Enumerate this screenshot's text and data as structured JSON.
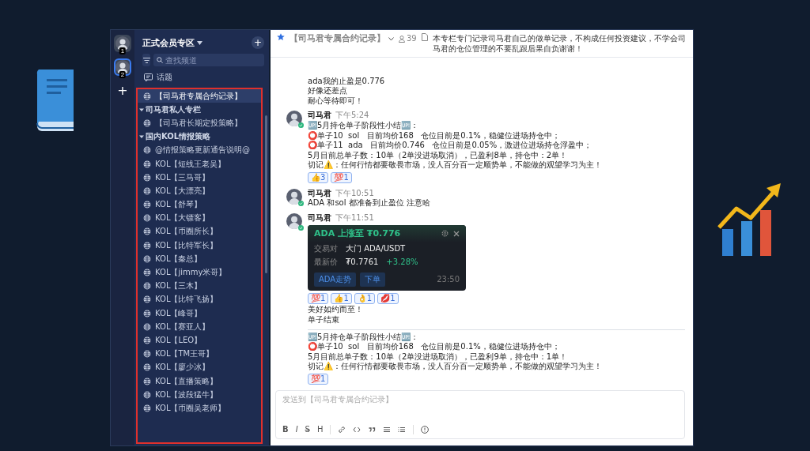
{
  "servers": [
    {
      "badge": "1",
      "selected": false
    },
    {
      "badge": "2",
      "selected": true
    }
  ],
  "add_server": "+",
  "sidebar": {
    "title": "正式会员专区",
    "add": "+",
    "search_placeholder": "查找频道",
    "topics": "话题",
    "channels": [
      {
        "name": "【司马君专属合约记录】",
        "selected": true
      }
    ],
    "categories": [
      {
        "name": "司马君私人专栏",
        "expanded": true,
        "channels": [
          {
            "name": "【司马君长期定投策略】",
            "selected": false
          }
        ]
      },
      {
        "name": "国内KOL情报策略",
        "expanded": true,
        "channels": [
          {
            "name": "@情报策略更新通告说明@",
            "selected": false
          },
          {
            "name": "KOL【短线王老吴】",
            "selected": false
          },
          {
            "name": "KOL【三马哥】",
            "selected": false
          },
          {
            "name": "KOL【大漂亮】",
            "selected": false
          },
          {
            "name": "KOL【舒琴】",
            "selected": false
          },
          {
            "name": "KOL【大镖客】",
            "selected": false
          },
          {
            "name": "KOL【币圈所长】",
            "selected": false
          },
          {
            "name": "KOL【比特军长】",
            "selected": false
          },
          {
            "name": "KOL【秦总】",
            "selected": false
          },
          {
            "name": "KOL【jimmy米哥】",
            "selected": false
          },
          {
            "name": "KOL【三木】",
            "selected": false
          },
          {
            "name": "KOL【比特飞扬】",
            "selected": false
          },
          {
            "name": "KOL【峰哥】",
            "selected": false
          },
          {
            "name": "KOL【赛亚人】",
            "selected": false
          },
          {
            "name": "KOL【LEO】",
            "selected": false
          },
          {
            "name": "KOL【TM王哥】",
            "selected": false
          },
          {
            "name": "KOL【廖少冰】",
            "selected": false
          },
          {
            "name": "KOL【直播策略】",
            "selected": false
          },
          {
            "name": "KOL【波段猛牛】",
            "selected": false
          },
          {
            "name": "KOL【币圈吴老师】",
            "selected": false
          }
        ]
      }
    ]
  },
  "chat": {
    "title": "【司马君专属合约记录】",
    "member_count": "39",
    "description": "本专栏专门记录司马君自己的做单记录，不构成任何投资建议，不学会司马君的仓位管理的不要乱跟后果自负谢谢！",
    "messages": [
      {
        "kind": "continuation",
        "lines": [
          "ada我的止盈是0.776",
          "好像还差点",
          "耐心等待即可！"
        ]
      },
      {
        "kind": "message",
        "author": "司马君",
        "time": "下午5:24",
        "lines": [
          "🆙5月持仓单子阶段性小结🆙：",
          "⭕单子10  sol   目前均价168   仓位目前是0.1%，稳健位进场持仓中；",
          "⭕单子11  ada   目前均价0.746   仓位目前是0.05%，激进位进场持仓浮盈中；",
          "5月目前总单子数：10单（2单没进场取消），已盈利8单，持仓中：2单！",
          "切记⚠️：任何行情都要敬畏市场，没人百分百一定顺势单，不能做的观望学习为主！"
        ],
        "reactions": [
          {
            "emoji": "👍",
            "count": "3"
          },
          {
            "emoji": "💯",
            "count": "1"
          }
        ]
      },
      {
        "kind": "message",
        "author": "司马君",
        "time": "下午10:51",
        "lines": [
          "ADA 和sol 都准备到止盈位 注意哈"
        ]
      },
      {
        "kind": "message",
        "author": "司马君",
        "time": "下午11:51",
        "card": {
          "title": "ADA 上涨至 ₮0.776",
          "rows": [
            {
              "label": "交易对",
              "value": "大门 ADA/USDT"
            },
            {
              "label": "最新价",
              "value": "₮0.7761",
              "change": "+3.28%"
            }
          ],
          "buttons": [
            "ADA走势",
            "下单"
          ],
          "time": "23:50"
        },
        "reactions": [
          {
            "emoji": "💯",
            "count": "1"
          },
          {
            "emoji": "👍",
            "count": "1"
          },
          {
            "emoji": "👌",
            "count": "1"
          },
          {
            "emoji": "💋",
            "count": "1"
          }
        ]
      },
      {
        "kind": "continuation",
        "lines": [
          "美好如约而至！",
          "单子结束"
        ]
      },
      {
        "kind": "divider"
      },
      {
        "kind": "continuation",
        "lines": [
          "🆙5月持仓单子阶段性小结🆙：",
          "⭕单子10  sol   目前均价168   仓位目前是0.1%，稳健位进场持仓中；",
          "5月目前总单子数：10单（2单没进场取消），已盈利9单，持仓中：1单！",
          "切记⚠️：任何行情都要敬畏市场，没人百分百一定顺势单，不能做的观望学习为主！"
        ],
        "reactions": [
          {
            "emoji": "💯",
            "count": "1"
          }
        ]
      }
    ],
    "composer": {
      "placeholder": "发送到【司马君专属合约记录】",
      "format_buttons": [
        {
          "kind": "bold",
          "label": "B"
        },
        {
          "kind": "italic",
          "label": "I"
        },
        {
          "kind": "strike",
          "label": "S"
        },
        {
          "kind": "heading",
          "label": "H"
        }
      ]
    }
  }
}
